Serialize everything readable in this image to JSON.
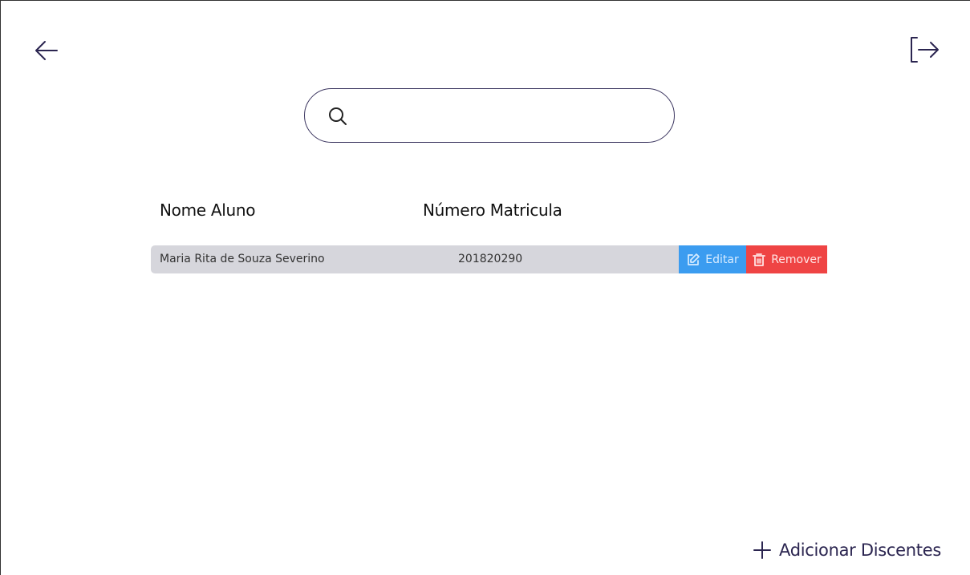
{
  "nav": {
    "back_icon": "arrow-left-icon",
    "logout_icon": "logout-icon"
  },
  "search": {
    "value": "",
    "placeholder": "",
    "icon": "search-icon"
  },
  "table": {
    "columns": [
      "Nome Aluno",
      "Número Matricula"
    ],
    "rows": [
      {
        "name": "Maria Rita de Souza Severino",
        "number": "201820290",
        "edit_label": "Editar",
        "remove_label": "Remover"
      }
    ]
  },
  "actions": {
    "add_label": "Adicionar Discentes",
    "add_icon": "plus-icon"
  },
  "colors": {
    "accent": "#2b2550",
    "edit": "#3b9cf0",
    "remove": "#ef4444",
    "row_bg": "#d6d6dc"
  }
}
